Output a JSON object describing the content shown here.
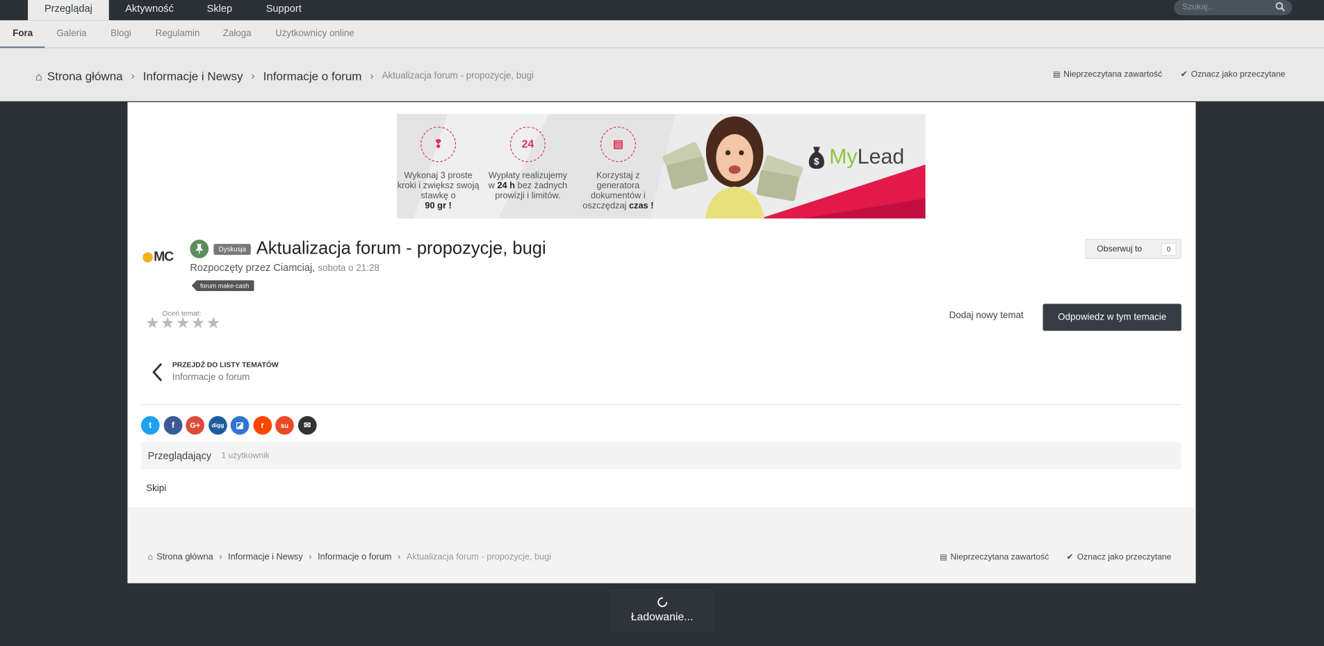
{
  "topnav": {
    "tabs": [
      {
        "label": "Przeglądaj",
        "active": true
      },
      {
        "label": "Aktywność",
        "active": false
      },
      {
        "label": "Sklep",
        "active": false
      },
      {
        "label": "Support",
        "active": false
      }
    ],
    "search_placeholder": "Szukaj..."
  },
  "subnav": {
    "items": [
      "Fora",
      "Galeria",
      "Blogi",
      "Regulamin",
      "Załoga",
      "Użytkownicy online"
    ]
  },
  "breadcrumb": {
    "home": "Strona główna",
    "level1": "Informacje i Newsy",
    "level2": "Informacje o forum",
    "current": "Aktualizacja forum - propozycje, bugi"
  },
  "actions": {
    "unread": "Nieprzeczytana zawartość",
    "mark_read": "Oznacz jako przeczytane"
  },
  "banner": {
    "col1": {
      "icon": "footsteps-icon",
      "line1": "Wykonaj 3 proste kroki i zwiększ swoją stawkę o",
      "bold": "90 gr !"
    },
    "col2": {
      "icon": "24h-icon",
      "badge": "24",
      "pre": "Wypłaty realizujemy w",
      "bold": "24 h",
      "post": "bez żadnych prowizji i limitów."
    },
    "col3": {
      "icon": "document-icon",
      "line1": "Korzystaj z generatora dokumentów i oszczędzaj",
      "bold": "czas !"
    },
    "brand_prefix": "My",
    "brand_suffix": "Lead"
  },
  "topic": {
    "logo_text": "MC",
    "badge": "Dyskusja",
    "title": "Aktualizacja forum - propozycje, bugi",
    "started_by_prefix": "Rozpoczęty przez",
    "author": "Ciamciaj",
    "date": "sobota o 21:28",
    "tag": "forum make-cash",
    "follow_label": "Obserwuj to",
    "follow_count": "0",
    "rate_label": "Oceń temat:",
    "rating": 0,
    "new_topic": "Dodaj nowy temat",
    "reply": "Odpowiedz w tym temacie",
    "back_label": "PRZEJDŹ DO LISTY TEMATÓW",
    "back_sub": "Informacje o forum"
  },
  "share": [
    {
      "name": "twitter-share-icon",
      "color": "#1da1f2",
      "glyph": "t"
    },
    {
      "name": "facebook-share-icon",
      "color": "#3b5998",
      "glyph": "f"
    },
    {
      "name": "googleplus-share-icon",
      "color": "#dd4b39",
      "glyph": "G+"
    },
    {
      "name": "digg-share-icon",
      "color": "#1d5d9e",
      "glyph": "digg"
    },
    {
      "name": "delicious-share-icon",
      "color": "#3274d1",
      "glyph": "◪"
    },
    {
      "name": "reddit-share-icon",
      "color": "#ff4500",
      "glyph": "r"
    },
    {
      "name": "stumbleupon-share-icon",
      "color": "#eb4924",
      "glyph": "su"
    },
    {
      "name": "email-share-icon",
      "color": "#333333",
      "glyph": "✉"
    }
  ],
  "viewers": {
    "title": "Przeglądający",
    "count": "1 użytkownik",
    "users": [
      "Skipi"
    ]
  },
  "loading": "Ładowanie..."
}
